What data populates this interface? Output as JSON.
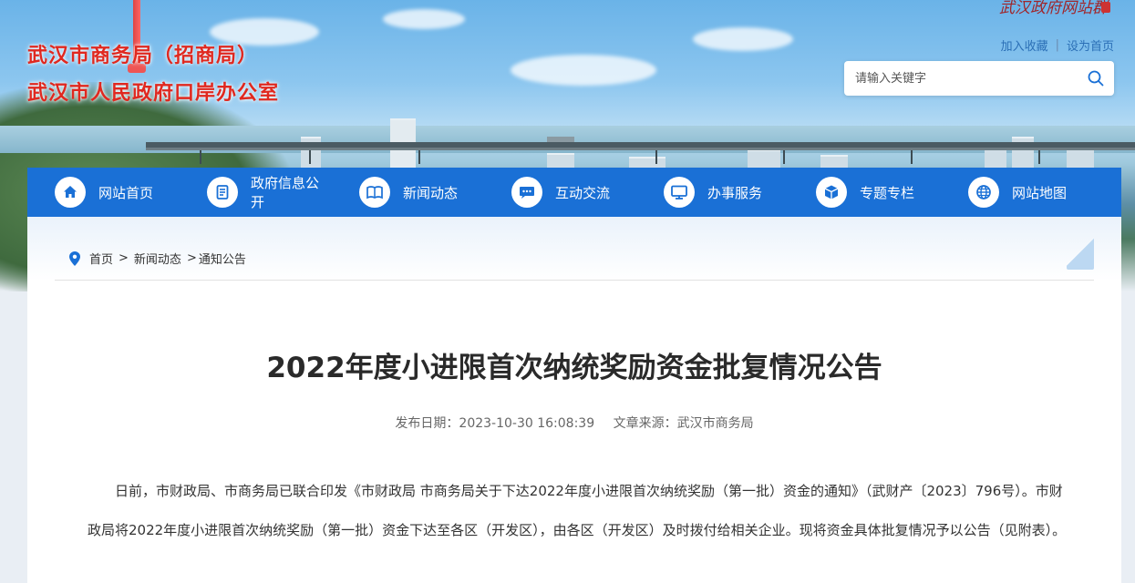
{
  "header": {
    "title_line1": "武汉市商务局（招商局）",
    "title_line2": "武汉市人民政府口岸办公室",
    "brand_mark": "武汉政府网站群",
    "links": [
      "加入收藏",
      "设为首页"
    ],
    "link_separator": "|",
    "search_placeholder": "请输入关键字"
  },
  "nav": {
    "items": [
      {
        "label": "网站首页",
        "icon": "home-icon"
      },
      {
        "label": "政府信息公开",
        "icon": "document-icon"
      },
      {
        "label": "新闻动态",
        "icon": "book-icon"
      },
      {
        "label": "互动交流",
        "icon": "chat-icon"
      },
      {
        "label": "办事服务",
        "icon": "monitor-icon"
      },
      {
        "label": "专题专栏",
        "icon": "cube-icon"
      },
      {
        "label": "网站地图",
        "icon": "globe-icon"
      }
    ]
  },
  "breadcrumb": {
    "items": [
      "首页",
      "新闻动态",
      "通知公告"
    ],
    "separator": ">"
  },
  "article": {
    "title": "2022年度小进限首次纳统奖励资金批复情况公告",
    "date_label": "发布日期：2023-10-30 16:08:39",
    "source_label": "文章来源：武汉市商务局",
    "paragraph": "日前，市财政局、市商务局已联合印发《市财政局 市商务局关于下达2022年度小进限首次纳统奖励（第一批）资金的通知》（武财产〔2023〕796号）。市财政局将2022年度小进限首次纳统奖励（第一批）资金下达至各区（开发区），由各区（开发区）及时拨付给相关企业。现将资金具体批复情况予以公告（见附表）。"
  },
  "colors": {
    "nav_bg": "#1a70d6",
    "title_red": "#e0281f",
    "link_blue": "#2b6fb6"
  }
}
